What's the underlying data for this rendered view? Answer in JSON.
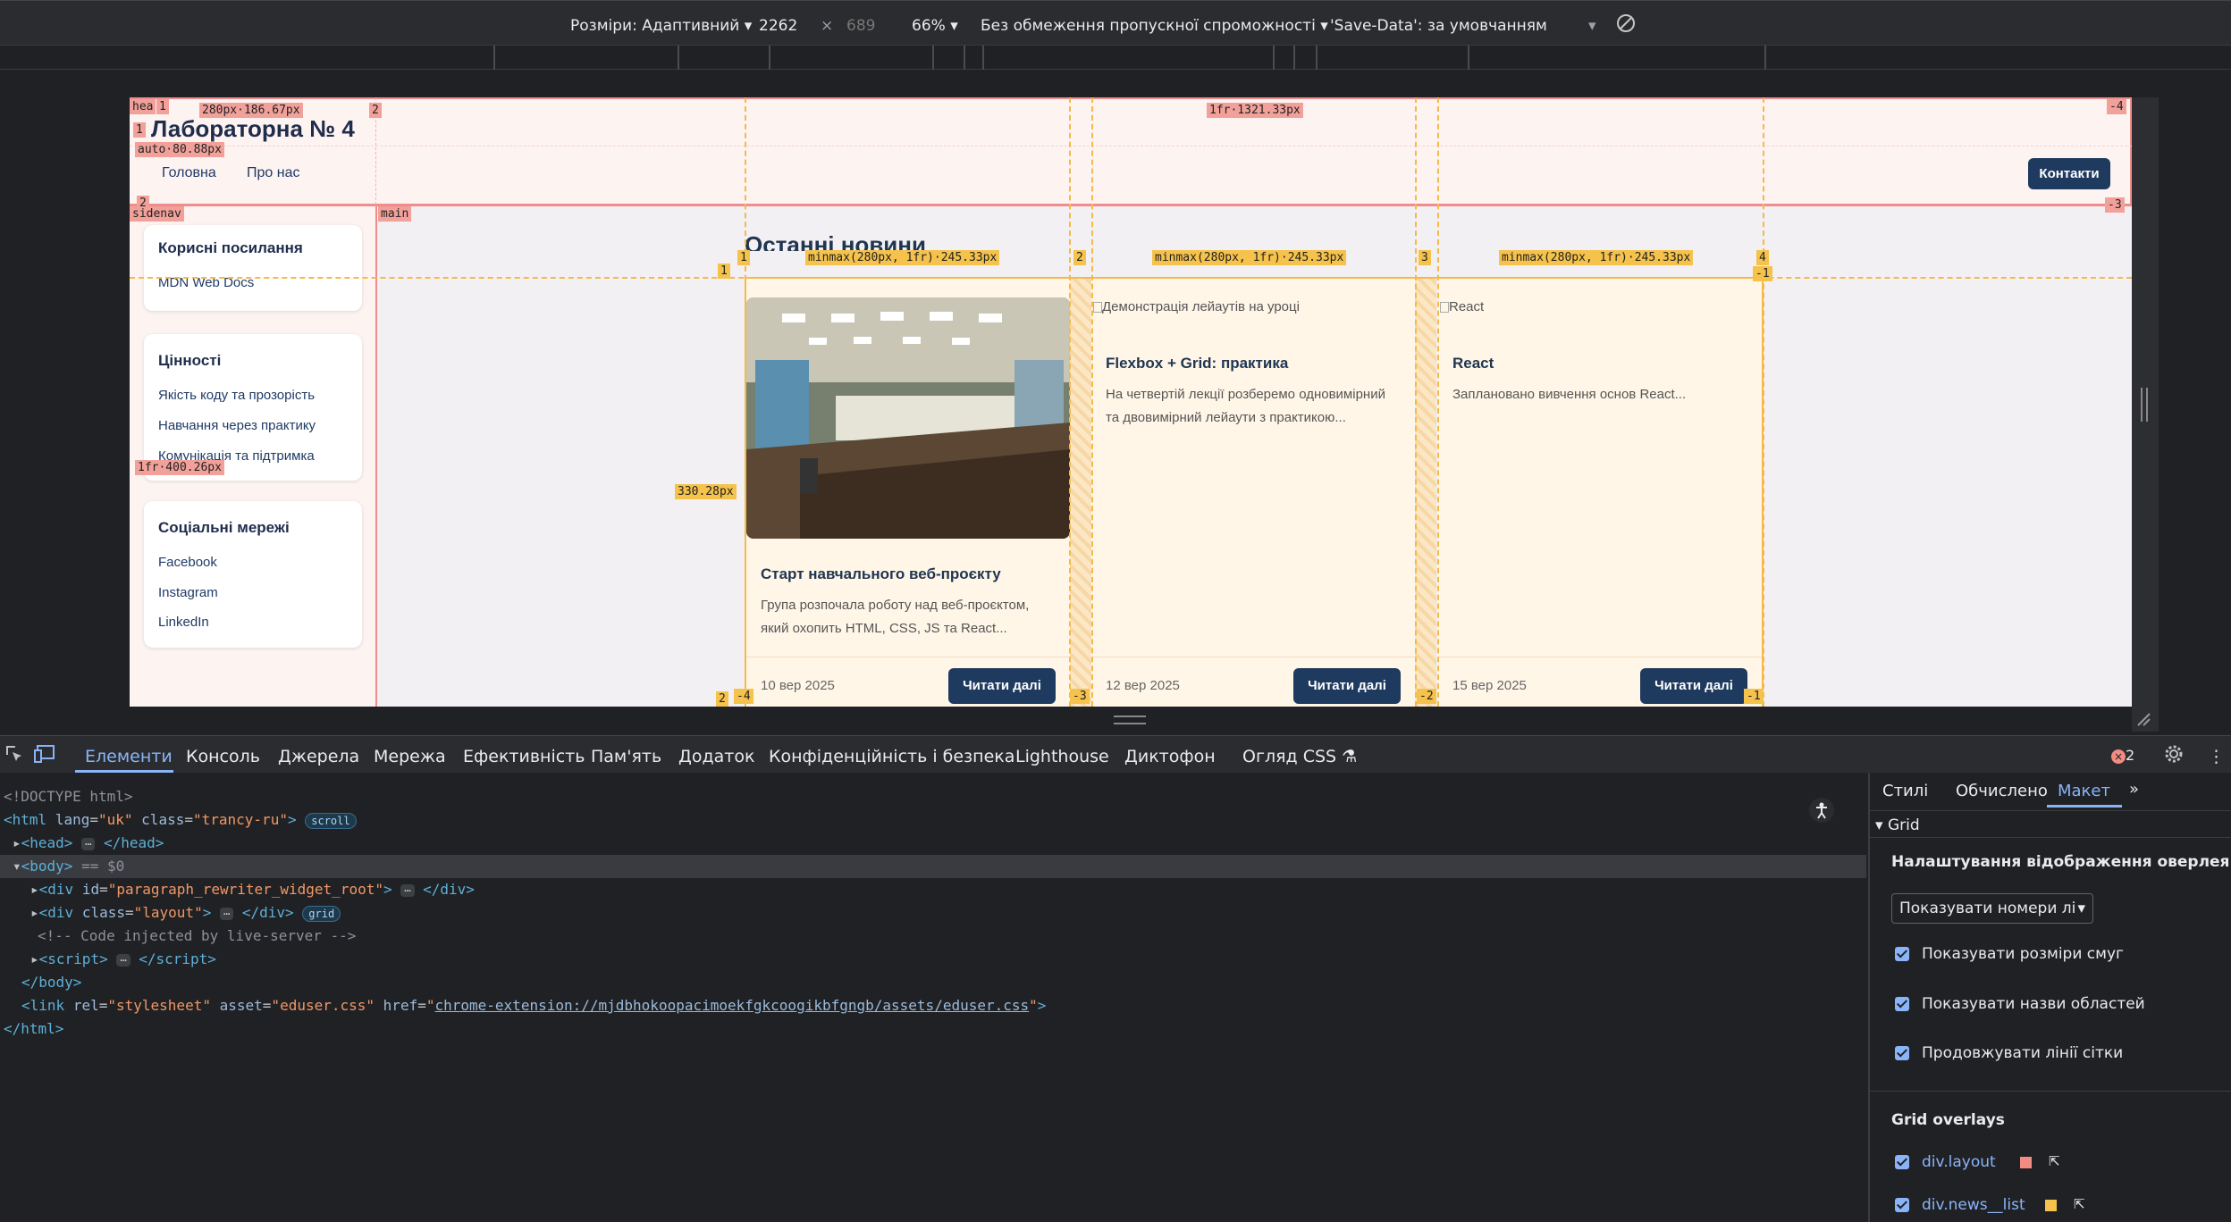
{
  "device_toolbar": {
    "dimensions_label": "Розміри: Адаптивний",
    "width": "2262",
    "times": "×",
    "height": "689",
    "zoom": "66%",
    "throttle": "Без обмеження пропускної спроможності",
    "save_data": "'Save-Data': за умовчанням"
  },
  "site": {
    "title": "Лабораторна № 4",
    "nav": [
      "Головна",
      "Про нас"
    ],
    "contact_button": "Контакти",
    "section_title": "Останні новини",
    "sidebar": [
      {
        "title": "Корисні посилання",
        "links": [
          "MDN Web Docs"
        ]
      },
      {
        "title": "Цінності",
        "links": [
          "Якість коду та прозорість",
          "Навчання через практику",
          "Комунікація та підтримка"
        ]
      },
      {
        "title": "Соціальні мережі",
        "links": [
          "Facebook",
          "Instagram",
          "LinkedIn"
        ]
      }
    ],
    "news": [
      {
        "alt": "",
        "title": "Старт навчального веб-проєкту",
        "text": "Група розпочала роботу над веб-проєктом, який охопить HTML, CSS, JS та React...",
        "date": "10 вер 2025",
        "button": "Читати далі"
      },
      {
        "alt": "Демонстрація лейаутів на уроці",
        "title": "Flexbox + Grid: практика",
        "text": "На четвертій лекції розберемо одновимірний та двовимірний лейаути з практикою...",
        "date": "12 вер 2025",
        "button": "Читати далі"
      },
      {
        "alt": "React",
        "title": "React",
        "text": "Заплановано вивчення основ React...",
        "date": "15 вер 2025",
        "button": "Читати далі"
      }
    ]
  },
  "overlay": {
    "layout_labels": {
      "header_area": "hea",
      "col1_line": "1",
      "col1_size": "280px·186.67px",
      "col2_line": "2",
      "col2_size": "1fr·1321.33px",
      "neg_col": "-4",
      "row1_line": "1",
      "row1_size": "auto·80.88px",
      "row2_line": "2",
      "sidenav_area": "sidenav",
      "main_area": "main",
      "neg_row": "-3",
      "row2_size": "1fr·400.26px"
    },
    "news_labels": {
      "col_lines": [
        "1",
        "2",
        "3",
        "4"
      ],
      "col_size": "minmax(280px, 1fr)·245.33px",
      "row_line": "1",
      "row_size": "330.28px",
      "neg_row": "-1",
      "bottom": [
        "-4",
        "-3",
        "-2",
        "-1"
      ],
      "row2": "2"
    }
  },
  "devtools": {
    "tabs": [
      "Елементи",
      "Консоль",
      "Джерела",
      "Мережа",
      "Ефективність",
      "Пам'ять",
      "Додаток",
      "Конфіденційність і безпека",
      "Lighthouse",
      "Диктофон",
      "Огляд CSS"
    ],
    "error_count": "2",
    "dom": {
      "doctype": "<!DOCTYPE html>",
      "html_lang": "uk",
      "html_class": "trancy-ru",
      "scroll_badge": "scroll",
      "body_eq": "== $0",
      "div1_id": "paragraph_rewriter_widget_root",
      "div2_class": "layout",
      "grid_badge": "grid",
      "comment": "<!-- Code injected by live-server -->",
      "link_rel": "stylesheet",
      "link_asset": "eduser.css",
      "link_href": "chrome-extension://mjdbhokoopacimoekfgkcoogikbfgngb/assets/eduser.css"
    },
    "side_tabs": [
      "Стилі",
      "Обчислено",
      "Макет"
    ],
    "grid_section": "Grid",
    "overlay_settings_title": "Налаштування відображення оверлея",
    "line_numbers_select": "Показувати номери лі",
    "checkboxes": [
      "Показувати розміри смуг",
      "Показувати назви областей",
      "Продовжувати лінії сітки"
    ],
    "grid_overlays_title": "Grid overlays",
    "overlays": [
      {
        "name": "div.layout",
        "color": "#f28b82"
      },
      {
        "name": "div.news__list",
        "color": "#f5c24c"
      }
    ]
  }
}
